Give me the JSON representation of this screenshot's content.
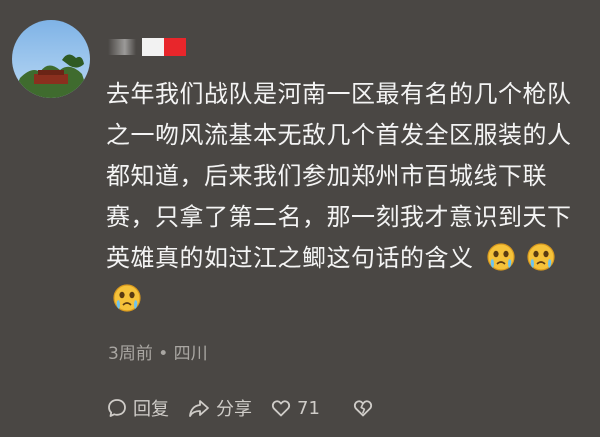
{
  "comment": {
    "text": "去年我们战队是河南一区最有名的几个枪队之一吻风流基本无敌几个首发全区服装的人都知道，后来我们参加郑州市百城线下联赛，只拿了第二名，那一刻我才意识到天下英雄真的如过江之鲫这句话的含义",
    "emoji_icon": "crying-face-emoji-icon"
  },
  "meta": {
    "time_location": "3周前 • 四川"
  },
  "actions": {
    "reply_label": "回复",
    "share_label": "分享",
    "like_count": "71"
  },
  "colors": {
    "background": "#4a4744",
    "text": "#f4f4f4",
    "meta": "#a9a6a2"
  }
}
